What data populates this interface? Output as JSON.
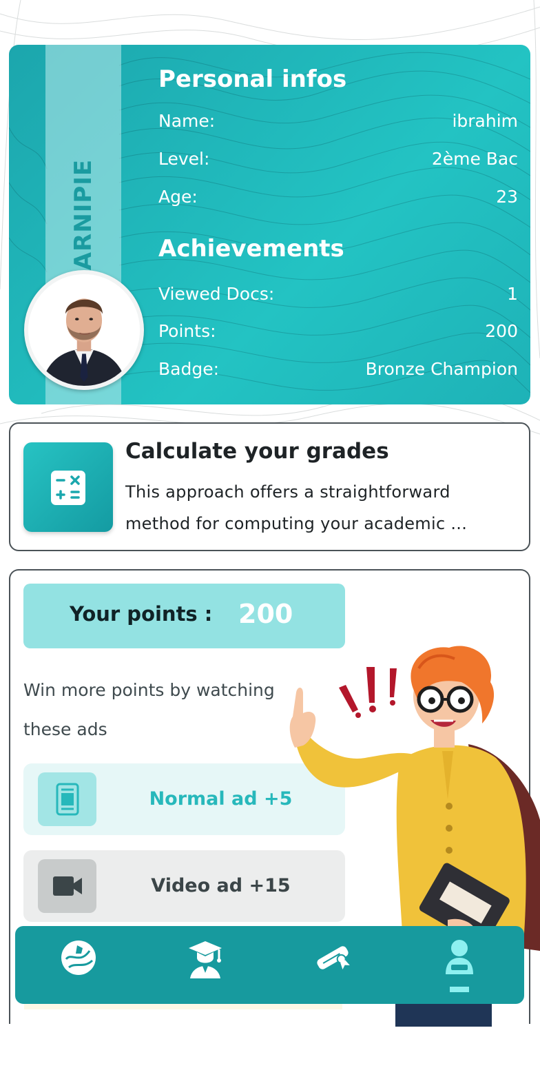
{
  "profile": {
    "brand": "LEARNIPIE",
    "personal_title": "Personal infos",
    "name_label": "Name:",
    "name_value": "ibrahim",
    "level_label": "Level:",
    "level_value": "2ème Bac",
    "age_label": "Age:",
    "age_value": "23",
    "achievements_title": "Achievements",
    "docs_label": "Viewed Docs:",
    "docs_value": "1",
    "points_label": "Points:",
    "points_value": "200",
    "badge_label": "Badge:",
    "badge_value": "Bronze Champion"
  },
  "grades": {
    "title": "Calculate your grades",
    "description": "This approach offers a straightforward method for computing your academic ..."
  },
  "points_section": {
    "label": "Your points :",
    "value": "200",
    "win_text": "Win more points by watching these ads",
    "normal_ad": "Normal ad +5",
    "video_ad": "Video ad +15"
  },
  "nav": {
    "items": [
      "home",
      "courses",
      "exams",
      "profile"
    ],
    "active": "profile"
  },
  "colors": {
    "accent": "#23c3c3",
    "accent_dark": "#179a9e",
    "points_banner": "#93e2e2",
    "active_icon": "#8ef0f0"
  },
  "icons": {
    "grades": "calculator-icon",
    "normal_ad": "phone-icon",
    "video_ad": "video-camera-icon",
    "nav_home": "globe-icon",
    "nav_courses": "graduate-icon",
    "nav_exams": "diploma-icon",
    "nav_profile": "user-icon"
  }
}
